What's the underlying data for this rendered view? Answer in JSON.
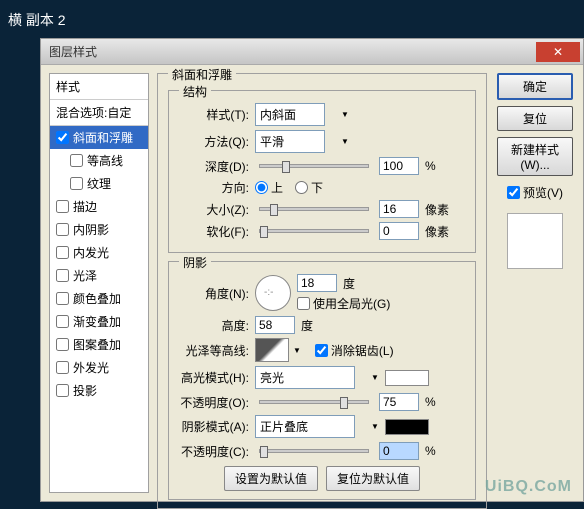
{
  "app_title": "横 副本 2",
  "dialog": {
    "title": "图层样式"
  },
  "styles_panel": {
    "header": "样式",
    "blend_opts": "混合选项:自定",
    "items": [
      {
        "label": "斜面和浮雕",
        "checked": true,
        "selected": true
      },
      {
        "label": "等高线",
        "checked": false,
        "indent": true
      },
      {
        "label": "纹理",
        "checked": false,
        "indent": true
      },
      {
        "label": "描边",
        "checked": false
      },
      {
        "label": "内阴影",
        "checked": false
      },
      {
        "label": "内发光",
        "checked": false
      },
      {
        "label": "光泽",
        "checked": false
      },
      {
        "label": "颜色叠加",
        "checked": false
      },
      {
        "label": "渐变叠加",
        "checked": false
      },
      {
        "label": "图案叠加",
        "checked": false
      },
      {
        "label": "外发光",
        "checked": false
      },
      {
        "label": "投影",
        "checked": false
      }
    ]
  },
  "bevel": {
    "group_title": "斜面和浮雕",
    "structure_title": "结构",
    "style_label": "样式(T):",
    "style_value": "内斜面",
    "technique_label": "方法(Q):",
    "technique_value": "平滑",
    "depth_label": "深度(D):",
    "depth_value": "100",
    "percent": "%",
    "direction_label": "方向:",
    "direction_up": "上",
    "direction_down": "下",
    "size_label": "大小(Z):",
    "size_value": "16",
    "px": "像素",
    "soften_label": "软化(F):",
    "soften_value": "0"
  },
  "shading": {
    "title": "阴影",
    "angle_label": "角度(N):",
    "angle_value": "18",
    "degree": "度",
    "global_light": "使用全局光(G)",
    "altitude_label": "高度:",
    "altitude_value": "58",
    "gloss_label": "光泽等高线:",
    "anti_alias": "消除锯齿(L)",
    "highlight_mode_label": "高光模式(H):",
    "highlight_mode_value": "亮光",
    "highlight_opacity_label": "不透明度(O):",
    "highlight_opacity_value": "75",
    "shadow_mode_label": "阴影模式(A):",
    "shadow_mode_value": "正片叠底",
    "shadow_opacity_label": "不透明度(C):",
    "shadow_opacity_value": "0"
  },
  "buttons": {
    "ok": "确定",
    "cancel": "复位",
    "new_style": "新建样式(W)...",
    "preview": "预览(V)",
    "make_default": "设置为默认值",
    "reset_default": "复位为默认值"
  },
  "watermark": "UiBQ.CoM"
}
